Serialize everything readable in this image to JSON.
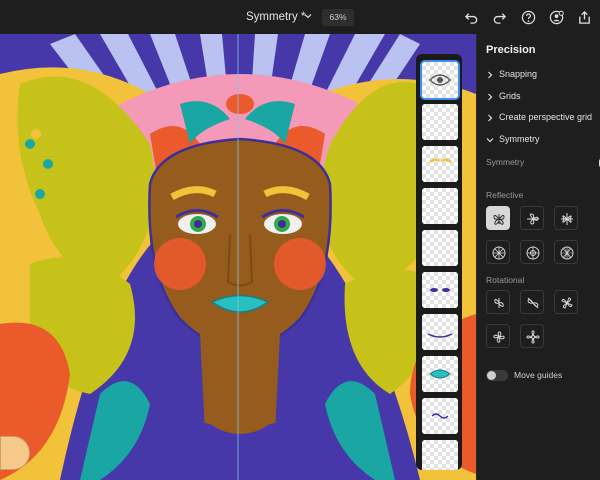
{
  "header": {
    "doc_title": "Symmetry *",
    "zoom": "63%",
    "icons": [
      "undo-icon",
      "redo-icon",
      "help-icon",
      "share-user-icon",
      "export-icon"
    ]
  },
  "layers": {
    "count_visible": 10,
    "selected_index": 0
  },
  "panel": {
    "title": "Precision",
    "sections": [
      {
        "label": "Snapping",
        "expanded": false
      },
      {
        "label": "Grids",
        "expanded": false
      },
      {
        "label": "Create perspective grid",
        "expanded": false
      },
      {
        "label": "Symmetry",
        "expanded": true
      }
    ],
    "symmetry_label": "Symmetry",
    "reflective_label": "Reflective",
    "rotational_label": "Rotational",
    "move_guides_label": "Move guides",
    "move_guides_on": false
  },
  "colors": {
    "accent": "#3d8ef0",
    "panel_bg": "#1e1e1e",
    "canvas_bg": "#4b3fb0"
  }
}
